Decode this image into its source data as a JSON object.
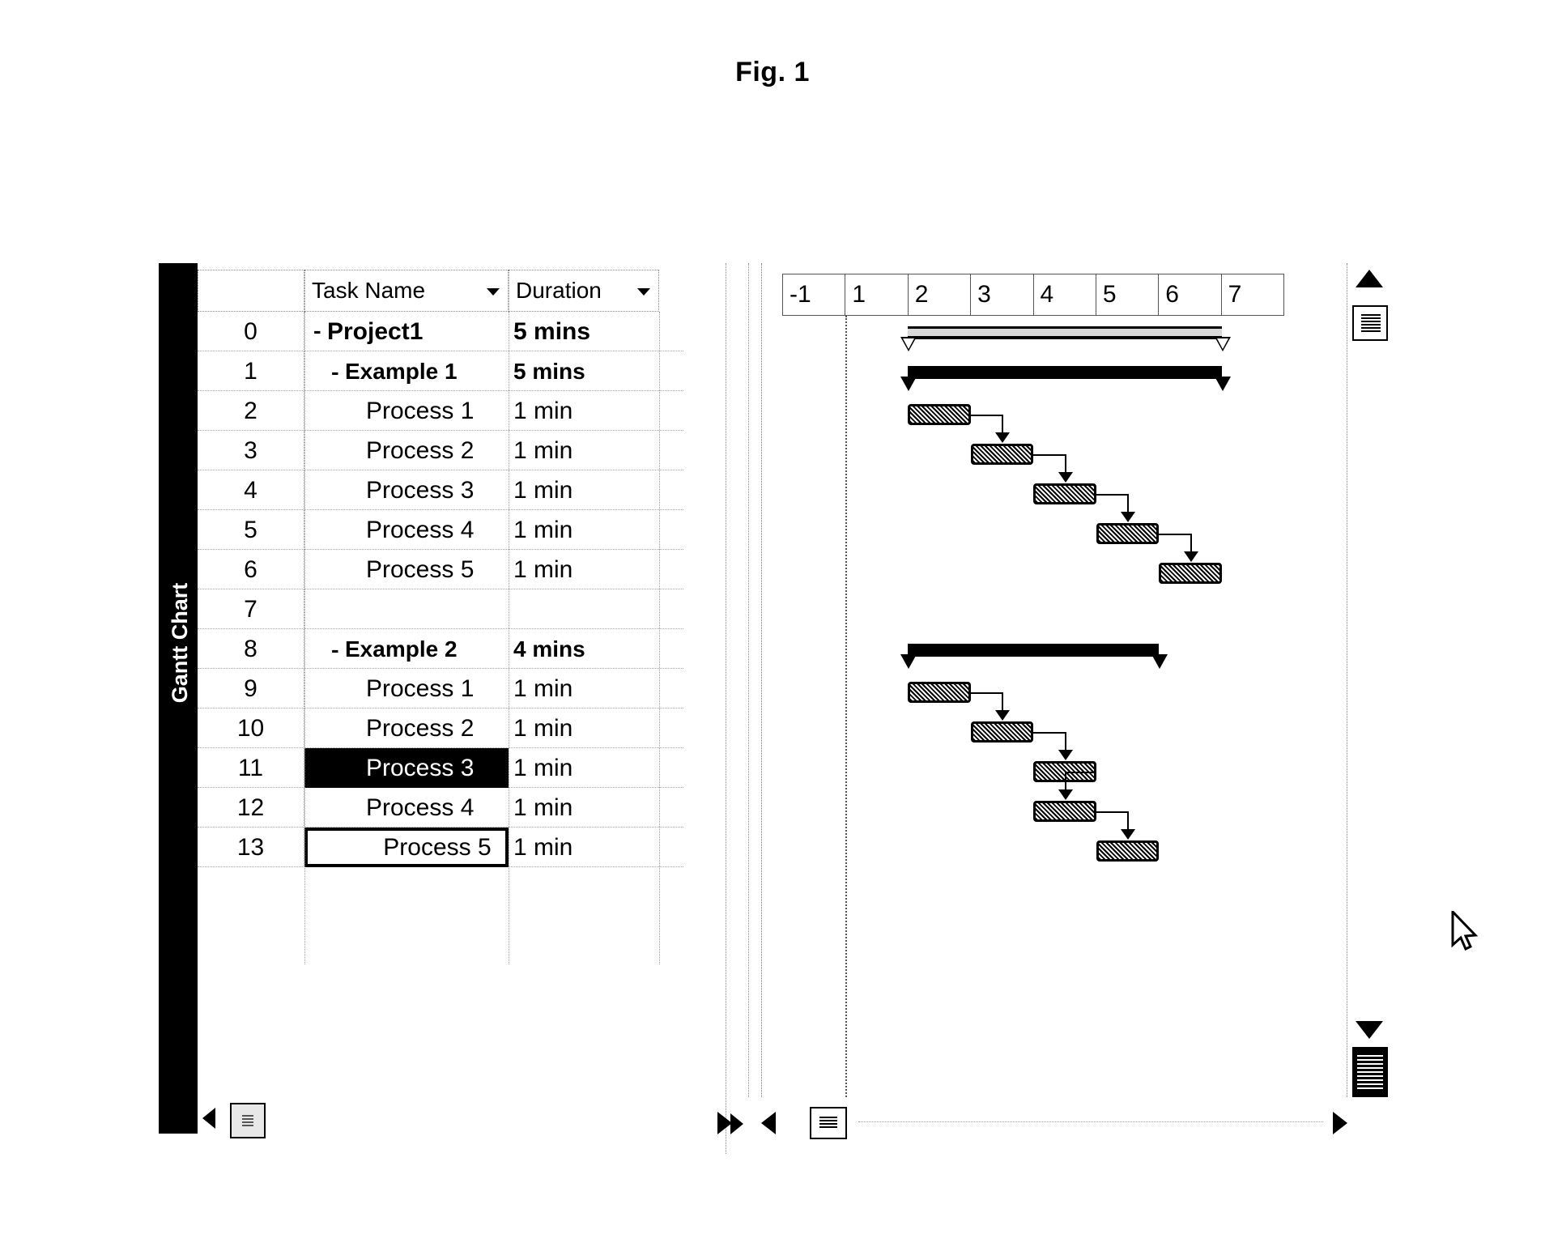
{
  "figure": {
    "caption": "Fig. 1"
  },
  "view_bar": {
    "label": "Gantt Chart"
  },
  "table": {
    "columns": [
      {
        "id": "id",
        "label": ""
      },
      {
        "id": "task_name",
        "label": "Task Name",
        "sort_icon": "chevron-down-icon"
      },
      {
        "id": "duration",
        "label": "Duration",
        "sort_icon": "chevron-down-icon"
      }
    ],
    "rows": [
      {
        "id": "0",
        "name": "Project1",
        "duration": "5 mins",
        "level": 0,
        "expander": "-",
        "state": "normal"
      },
      {
        "id": "1",
        "name": "Example 1",
        "duration": "5 mins",
        "level": 1,
        "expander": "-",
        "state": "normal"
      },
      {
        "id": "2",
        "name": "Process 1",
        "duration": "1 min",
        "level": 2,
        "expander": "",
        "state": "normal"
      },
      {
        "id": "3",
        "name": "Process 2",
        "duration": "1 min",
        "level": 2,
        "expander": "",
        "state": "normal"
      },
      {
        "id": "4",
        "name": "Process 3",
        "duration": "1 min",
        "level": 2,
        "expander": "",
        "state": "normal"
      },
      {
        "id": "5",
        "name": "Process 4",
        "duration": "1 min",
        "level": 2,
        "expander": "",
        "state": "normal"
      },
      {
        "id": "6",
        "name": "Process 5",
        "duration": "1 min",
        "level": 2,
        "expander": "",
        "state": "normal"
      },
      {
        "id": "7",
        "name": "",
        "duration": "",
        "level": 2,
        "expander": "",
        "state": "normal"
      },
      {
        "id": "8",
        "name": "Example 2",
        "duration": "4 mins",
        "level": 1,
        "expander": "-",
        "state": "normal"
      },
      {
        "id": "9",
        "name": "Process 1",
        "duration": "1 min",
        "level": 2,
        "expander": "",
        "state": "normal"
      },
      {
        "id": "10",
        "name": "Process 2",
        "duration": "1 min",
        "level": 2,
        "expander": "",
        "state": "normal"
      },
      {
        "id": "11",
        "name": "Process 3",
        "duration": "1 min",
        "level": 2,
        "expander": "",
        "state": "selected"
      },
      {
        "id": "12",
        "name": "Process 4",
        "duration": "1 min",
        "level": 2,
        "expander": "",
        "state": "normal"
      },
      {
        "id": "13",
        "name": "Process 5",
        "duration": "1 min",
        "level": 2,
        "expander": "",
        "state": "cursor"
      }
    ]
  },
  "chart_data": {
    "type": "bar",
    "title": "Gantt Chart",
    "xlabel": "",
    "ylabel": "",
    "axis_unit": "minutes",
    "tick_labels": [
      "-1",
      "1",
      "2",
      "3",
      "4",
      "5",
      "6",
      "7"
    ],
    "xlim": [
      -1,
      8
    ],
    "grid": true,
    "gridline_at": 1,
    "legend": "none",
    "bars": [
      {
        "task_id": "0",
        "name": "Project1",
        "start": 1,
        "duration": 5,
        "kind": "summary-hollow"
      },
      {
        "task_id": "1",
        "name": "Example 1",
        "start": 1,
        "duration": 5,
        "kind": "summary"
      },
      {
        "task_id": "2",
        "name": "Process 1",
        "start": 1,
        "duration": 1,
        "kind": "task"
      },
      {
        "task_id": "3",
        "name": "Process 2",
        "start": 2,
        "duration": 1,
        "kind": "task"
      },
      {
        "task_id": "4",
        "name": "Process 3",
        "start": 3,
        "duration": 1,
        "kind": "task"
      },
      {
        "task_id": "5",
        "name": "Process 4",
        "start": 4,
        "duration": 1,
        "kind": "task"
      },
      {
        "task_id": "6",
        "name": "Process 5",
        "start": 5,
        "duration": 1,
        "kind": "task"
      },
      {
        "task_id": "8",
        "name": "Example 2",
        "start": 1,
        "duration": 4,
        "kind": "summary"
      },
      {
        "task_id": "9",
        "name": "Process 1",
        "start": 1,
        "duration": 1,
        "kind": "task"
      },
      {
        "task_id": "10",
        "name": "Process 2",
        "start": 2,
        "duration": 1,
        "kind": "task"
      },
      {
        "task_id": "11",
        "name": "Process 3",
        "start": 3,
        "duration": 1,
        "kind": "task"
      },
      {
        "task_id": "12",
        "name": "Process 4",
        "start": 3,
        "duration": 1,
        "kind": "task"
      },
      {
        "task_id": "13",
        "name": "Process 5",
        "start": 4,
        "duration": 1,
        "kind": "task"
      }
    ],
    "links": [
      {
        "from": "2",
        "to": "3"
      },
      {
        "from": "3",
        "to": "4"
      },
      {
        "from": "4",
        "to": "5"
      },
      {
        "from": "5",
        "to": "6"
      },
      {
        "from": "9",
        "to": "10"
      },
      {
        "from": "10",
        "to": "11"
      },
      {
        "from": "11",
        "to": "12"
      },
      {
        "from": "12",
        "to": "13"
      }
    ]
  },
  "colors": {
    "bar_fill": "#000000",
    "bar_border": "#000000",
    "selection": "#000000",
    "selection_text": "#ffffff",
    "grid": "#9a9a9a",
    "background": "#ffffff"
  },
  "scrollbars": {
    "table_h": {
      "left_icon": "triangle-left-icon",
      "thumb_icon": "scroll-thumb-icon"
    },
    "chart_h": {
      "left_icon": "triangle-left-icon",
      "right_icon": "triangle-right-icon",
      "thumb_icon": "scroll-thumb-icon"
    },
    "chart_v": {
      "up_icon": "triangle-up-icon",
      "down_icon": "triangle-down-icon",
      "thumb_icon": "scroll-thumb-icon"
    }
  },
  "cursor": {
    "icon": "mouse-pointer-icon"
  }
}
